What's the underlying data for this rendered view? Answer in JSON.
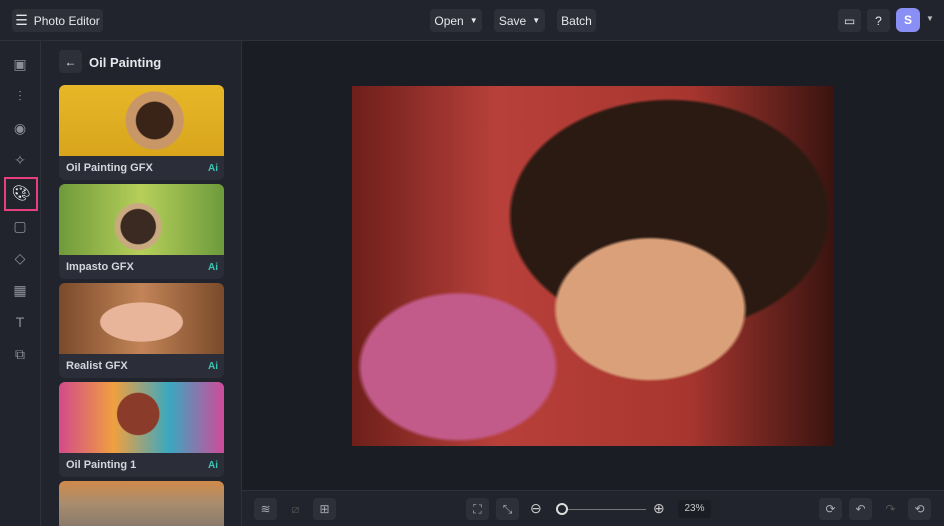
{
  "header": {
    "app_title": "Photo Editor",
    "open_label": "Open",
    "save_label": "Save",
    "batch_label": "Batch",
    "avatar_initial": "S"
  },
  "panel": {
    "title": "Oil Painting",
    "items": [
      {
        "label": "Oil Painting GFX",
        "badge": "Ai"
      },
      {
        "label": "Impasto GFX",
        "badge": "Ai"
      },
      {
        "label": "Realist GFX",
        "badge": "Ai"
      },
      {
        "label": "Oil Painting 1",
        "badge": "Ai"
      }
    ]
  },
  "footer": {
    "zoom_value": "23%",
    "zoom_fraction": 0.02
  },
  "colors": {
    "accent": "#e6407f",
    "ai": "#3cc4b4",
    "avatar": "#8a8ff5"
  }
}
